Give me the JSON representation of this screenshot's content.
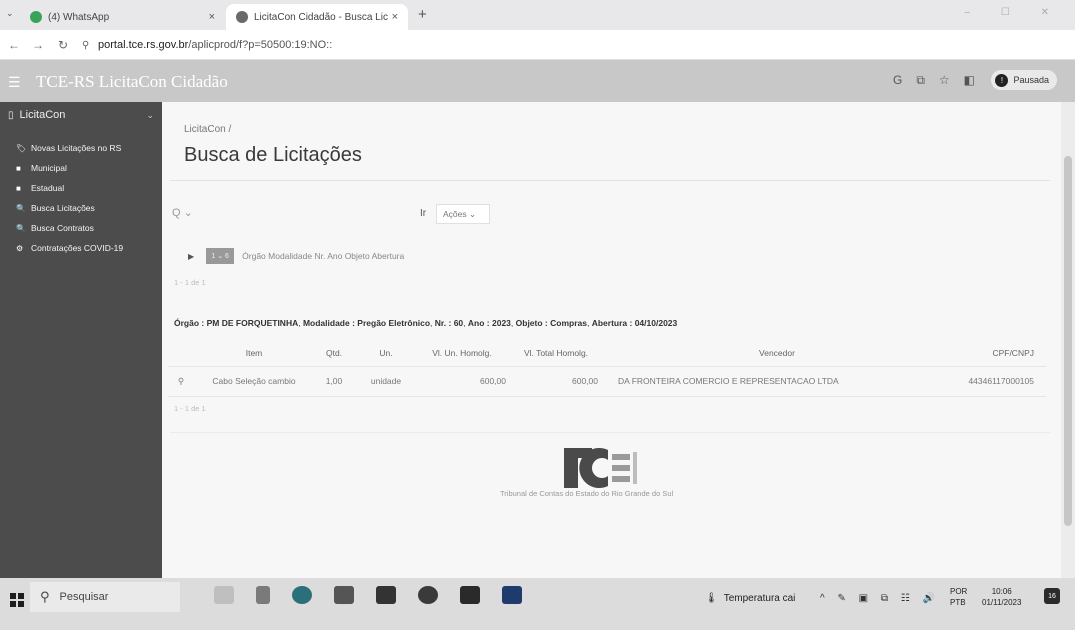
{
  "browser": {
    "tabs": [
      {
        "label": "(4) WhatsApp",
        "close": "×"
      },
      {
        "label": "LicitaCon Cidadão - Busca Lic",
        "close": "×"
      }
    ],
    "new_tab": "+",
    "address": {
      "host": "portal.tce.rs.gov.br",
      "path": "/aplicprod/f?p=50500:19:NO::"
    },
    "profile_label": "Pausada",
    "profile_initial": "!"
  },
  "app": {
    "title": "TCE-RS LicitaCon Cidadão"
  },
  "sidebar": {
    "title": "LicitaCon",
    "items": [
      {
        "label": "Novas Licitações no RS",
        "icon": "🏷"
      },
      {
        "label": "Municipal",
        "icon": "■"
      },
      {
        "label": "Estadual",
        "icon": "■"
      },
      {
        "label": "Busca Licitações",
        "icon": "🔍"
      },
      {
        "label": "Busca Contratos",
        "icon": "🔍"
      },
      {
        "label": "Contratações COVID-19",
        "icon": "⚙"
      }
    ]
  },
  "page": {
    "breadcrumb": "LicitaCon  /",
    "title": "Busca de Licitações",
    "search_go": "Ir",
    "actions_label": "Ações ⌄",
    "filter_badge": "1 ⌄ 6",
    "filter_columns": "Órgão  Modalidade  Nr.  Ano  Objeto  Abertura",
    "pagination_top": "1 - 1 de 1",
    "group_header": {
      "orgao_label": "Órgão :",
      "orgao": "PM DE FORQUETINHA",
      "modalidade_label": "Modalidade :",
      "modalidade": "Pregão Eletrônico",
      "nr_label": "Nr. :",
      "nr": "60",
      "ano_label": "Ano :",
      "ano": "2023",
      "objeto_label": "Objeto :",
      "objeto": "Compras",
      "abertura_label": "Abertura :",
      "abertura": "04/10/2023"
    },
    "table": {
      "headers": {
        "item": "Item",
        "qtd": "Qtd.",
        "un": "Un.",
        "vl_un": "Vl. Un. Homolg.",
        "vl_total": "Vl. Total Homolg.",
        "vencedor": "Vencedor",
        "cpf_cnpj": "CPF/CNPJ"
      },
      "rows": [
        {
          "item": "Cabo Seleção cambio",
          "qtd": "1,00",
          "un": "unidade",
          "vl_un": "600,00",
          "vl_total": "600,00",
          "vencedor": "DA FRONTEIRA COMERCIO E REPRESENTACAO LTDA",
          "cpf_cnpj": "44346117000105"
        }
      ]
    },
    "pagination_bottom": "1 - 1 de 1",
    "logo_text": "TCE",
    "footer_caption": "Tribunal de Contas do Estado do Rio Grande do Sul"
  },
  "taskbar": {
    "search_placeholder": "Pesquisar",
    "weather": "Temperatura cai",
    "lang_line1": "POR",
    "lang_line2": "PTB",
    "time": "10:06",
    "date": "01/11/2023",
    "notification_count": "16"
  },
  "colors": {
    "sidebar_bg": "#4c4c4c",
    "header_bg": "#c8c8c8",
    "content_bg": "#f7f7f7"
  }
}
